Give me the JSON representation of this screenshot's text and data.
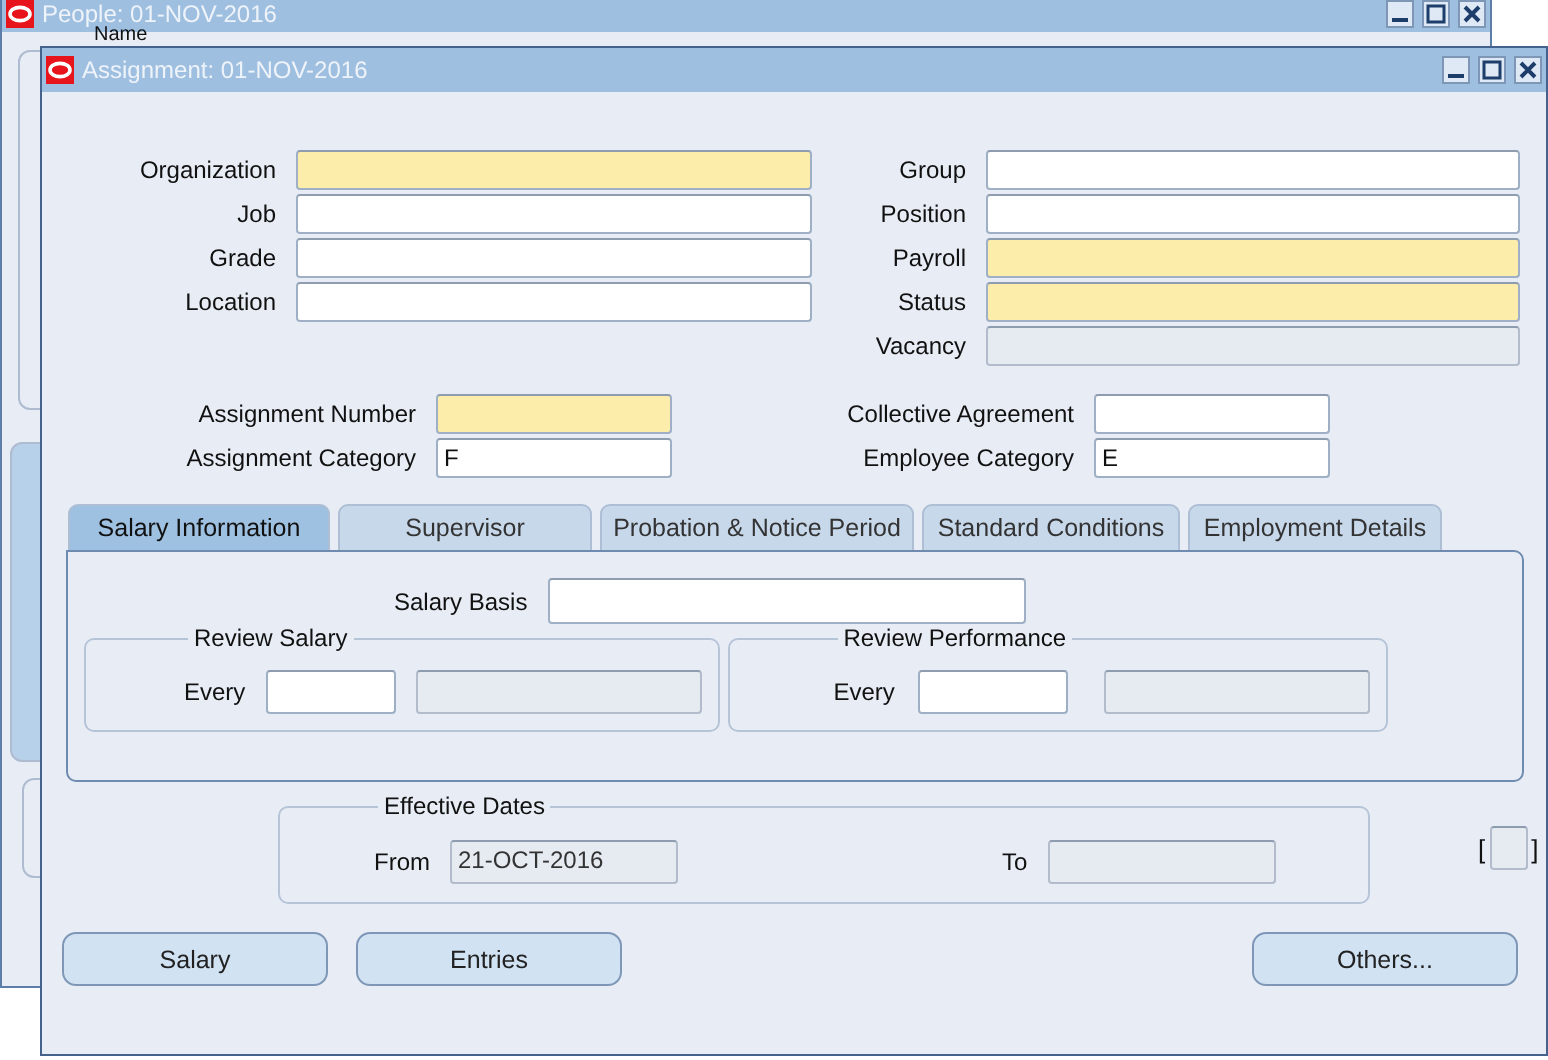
{
  "background_window": {
    "title": "People: 01-NOV-2016",
    "field_label": "Name"
  },
  "window": {
    "title": "Assignment: 01-NOV-2016"
  },
  "top_fields": [
    {
      "label": "Organization",
      "required": true,
      "disabled": false
    },
    {
      "label": "Group",
      "required": false,
      "disabled": false
    },
    {
      "label": "Job",
      "required": false,
      "disabled": false
    },
    {
      "label": "Position",
      "required": false,
      "disabled": false
    },
    {
      "label": "Grade",
      "required": false,
      "disabled": false
    },
    {
      "label": "Payroll",
      "required": true,
      "disabled": false
    },
    {
      "label": "Location",
      "required": false,
      "disabled": false
    },
    {
      "label": "Status",
      "required": true,
      "disabled": false
    },
    {
      "label": "Vacancy",
      "disabled": true
    }
  ],
  "assignment_fields": [
    {
      "label": "Assignment Number",
      "required": true
    },
    {
      "label": "Collective Agreement",
      "required": false
    },
    {
      "label": "Assignment Category",
      "required": false,
      "value": "F"
    },
    {
      "label": "Employee Category",
      "required": false,
      "value": "E"
    }
  ],
  "tabs": [
    {
      "label": "Salary Information",
      "selected": true
    },
    {
      "label": "Supervisor",
      "selected": false
    },
    {
      "label": "Probation & Notice Period",
      "selected": false
    },
    {
      "label": "Standard Conditions",
      "selected": false
    },
    {
      "label": "Employment Details",
      "selected": false
    }
  ],
  "salary": {
    "label": "Salary Basis",
    "groups": [
      {
        "title": "Review Salary",
        "label": "Every"
      },
      {
        "title": "Review Performance",
        "label": "Every"
      }
    ]
  },
  "effective_dates": {
    "title": "Effective Dates",
    "from_label": "From",
    "from_value": "21-OCT-2016",
    "to_label": "To"
  },
  "bracket": {
    "open": "[",
    "close": "]",
    "checked": false
  },
  "buttons_left": [
    "Salary",
    "Entries"
  ],
  "buttons_right": [
    "Others..."
  ]
}
